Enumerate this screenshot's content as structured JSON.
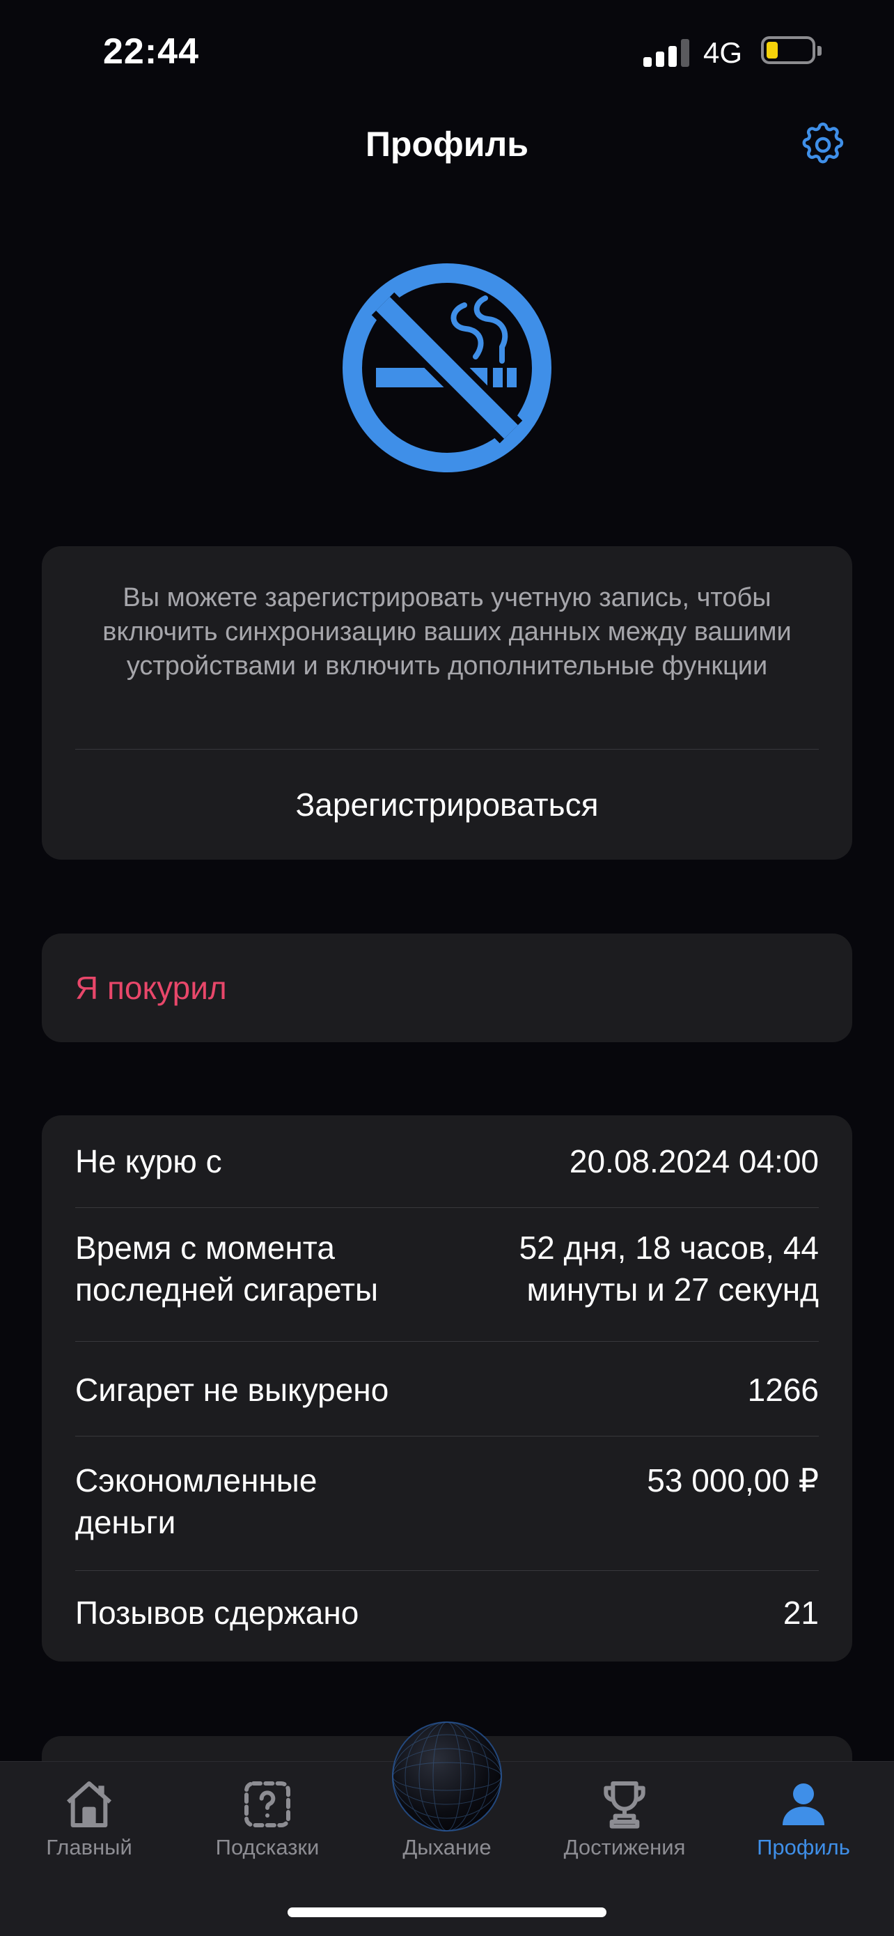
{
  "status_bar": {
    "time": "22:44",
    "network": "4G",
    "signal_bars_active": 3,
    "signal_bars_total": 4,
    "battery_level_fraction": 0.15,
    "battery_color": "#f5d20a"
  },
  "header": {
    "title": "Профиль",
    "settings_icon": "gear-icon"
  },
  "hero": {
    "icon": "no-smoking-icon",
    "color": "#3f8fe8"
  },
  "register_card": {
    "text": "Вы можете зарегистрировать учетную запись, чтобы включить синхронизацию ваших данных между вашими устройствами и включить дополнительные функции",
    "button_label": "Зарегистрироваться"
  },
  "smoked_card": {
    "label": "Я покурил",
    "color": "#e8476a"
  },
  "stats": [
    {
      "label": "Не курю с",
      "value": "20.08.2024 04:00"
    },
    {
      "label": "Время с момента последней сигареты",
      "value": "52 дня, 18 часов, 44 минуты и 27 секунд"
    },
    {
      "label": "Сигарет не выкурено",
      "value": "1266"
    },
    {
      "label": "Сэкономленные деньги",
      "value": "53 000,00 ₽"
    },
    {
      "label": "Позывов сдержано",
      "value": "21"
    }
  ],
  "tabs": [
    {
      "label": "Главный",
      "icon": "home-icon",
      "active": false
    },
    {
      "label": "Подсказки",
      "icon": "question-icon",
      "active": false
    },
    {
      "label": "Дыхание",
      "icon": "breathing-orb-icon",
      "active": false
    },
    {
      "label": "Достижения",
      "icon": "trophy-icon",
      "active": false
    },
    {
      "label": "Профиль",
      "icon": "person-icon",
      "active": true
    }
  ],
  "colors": {
    "background": "#07070c",
    "card": "#1c1c1f",
    "accent": "#3f8fe8",
    "muted_text": "#a6a6ab",
    "tab_inactive": "#8d8d93"
  }
}
